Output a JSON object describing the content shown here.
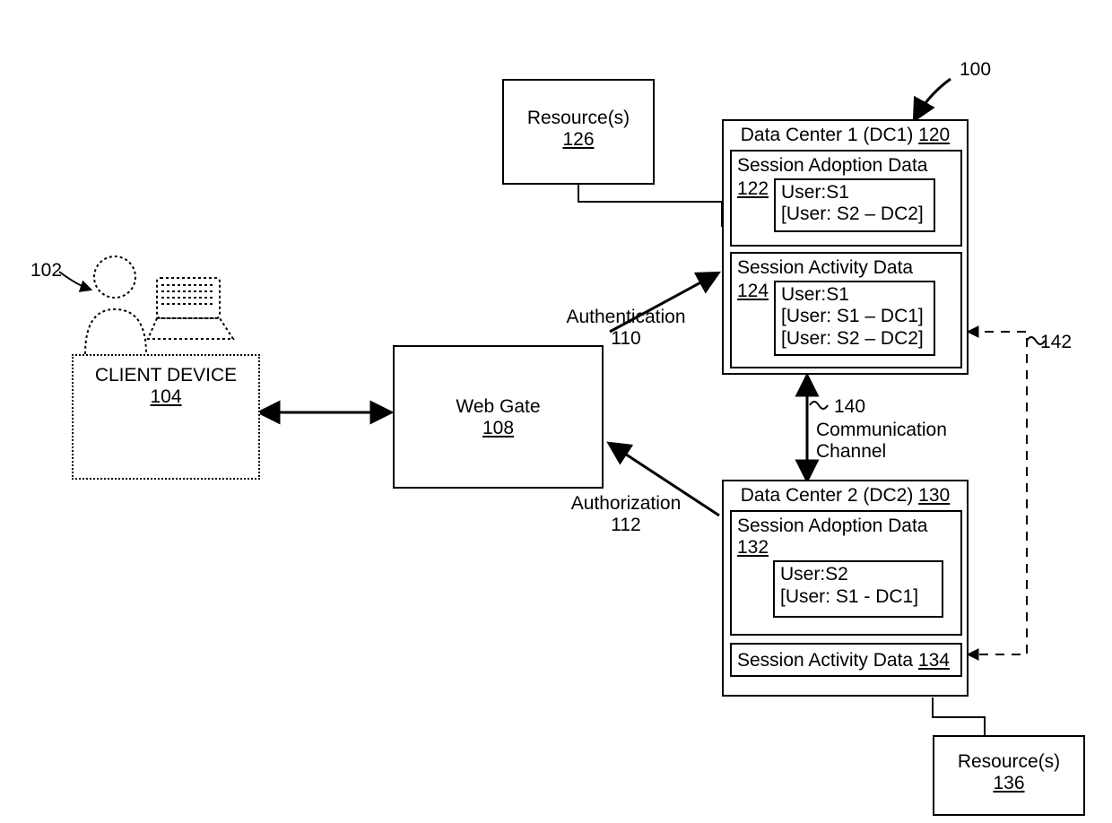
{
  "refs": {
    "r100": "100",
    "r102": "102",
    "r140": "140",
    "r142": "142",
    "auth_n_label": "Authentication",
    "auth_n_num": "110",
    "auth_z_label": "Authorization",
    "auth_z_num": "112",
    "comm_label": "Communication",
    "comm_label2": "Channel"
  },
  "client": {
    "label": "CLIENT DEVICE",
    "num": "104"
  },
  "webgate": {
    "label": "Web Gate",
    "num": "108"
  },
  "resources_top": {
    "label": "Resource(s)",
    "num": "126"
  },
  "resources_bot": {
    "label": "Resource(s)",
    "num": "136"
  },
  "dc1": {
    "title_a": "Data Center 1 (DC1) ",
    "title_num": "120",
    "adopt_label": "Session Adoption Data",
    "adopt_num": "122",
    "adopt_items": [
      "User:S1",
      "[User: S2 – DC2]"
    ],
    "act_label": "Session Activity Data",
    "act_num": "124",
    "act_items": [
      "User:S1",
      "[User: S1 – DC1]",
      "[User: S2 – DC2]"
    ]
  },
  "dc2": {
    "title_a": "Data Center 2 (DC2) ",
    "title_num": "130",
    "adopt_label": "Session Adoption Data",
    "adopt_num": "132",
    "adopt_items": [
      "User:S2",
      "[User: S1 - DC1]"
    ],
    "act_label": "Session Activity Data ",
    "act_num": "134"
  }
}
